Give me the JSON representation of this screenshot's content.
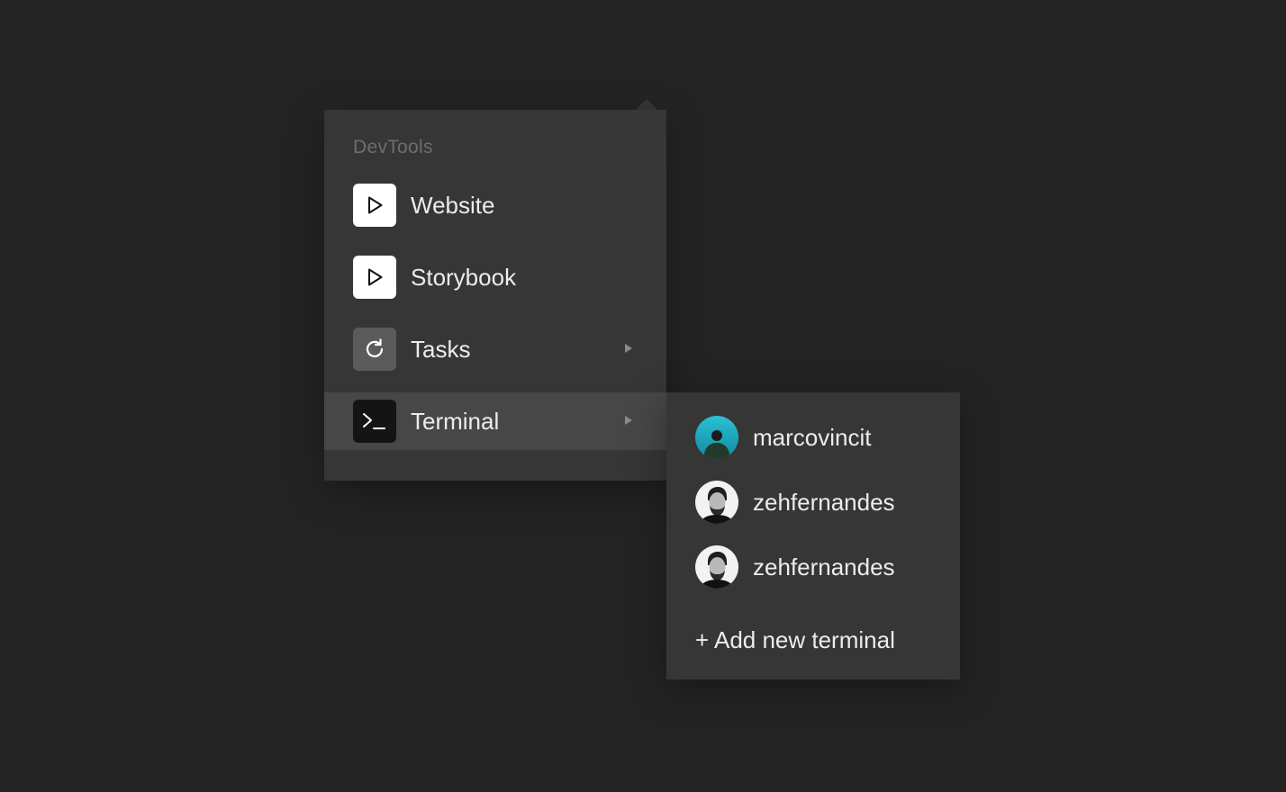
{
  "menu": {
    "section_title": "DevTools",
    "items": [
      {
        "label": "Website",
        "icon": "play-icon",
        "has_submenu": false,
        "active": false
      },
      {
        "label": "Storybook",
        "icon": "play-icon",
        "has_submenu": false,
        "active": false
      },
      {
        "label": "Tasks",
        "icon": "refresh-icon",
        "has_submenu": true,
        "active": false
      },
      {
        "label": "Terminal",
        "icon": "terminal-icon",
        "has_submenu": true,
        "active": true
      }
    ]
  },
  "submenu": {
    "items": [
      {
        "label": "marcovincit",
        "avatar": "avatar-teal"
      },
      {
        "label": "zehfernandes",
        "avatar": "avatar-bw"
      },
      {
        "label": "zehfernandes",
        "avatar": "avatar-bw"
      }
    ],
    "add_label": "+ Add new terminal"
  },
  "colors": {
    "background": "#242424",
    "menu_bg": "#363636",
    "active_item_bg": "#474747",
    "text": "#ececec",
    "muted_text": "#6e6e6e"
  }
}
